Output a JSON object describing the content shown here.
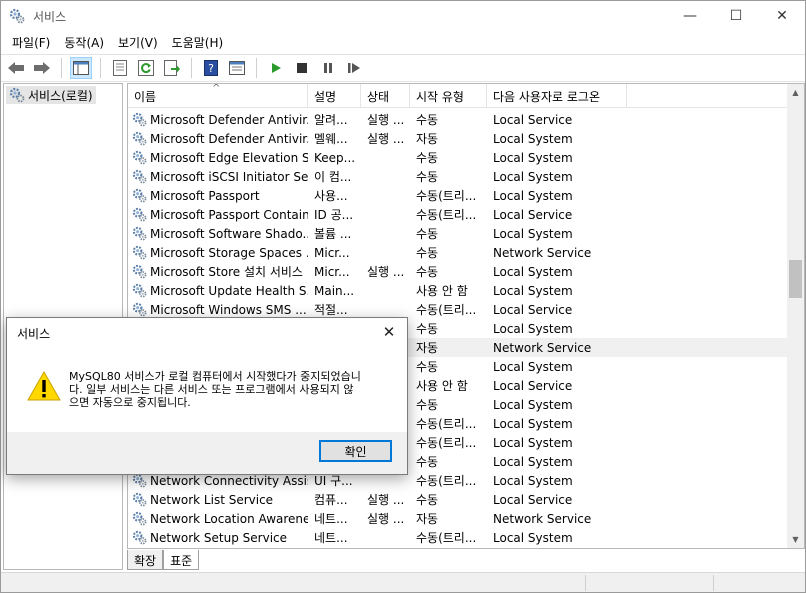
{
  "window": {
    "title": "서비스",
    "minimize_glyph": "—",
    "maximize_glyph": "☐",
    "close_glyph": "✕"
  },
  "menu": [
    "파일(F)",
    "동작(A)",
    "보기(V)",
    "도움말(H)"
  ],
  "toolbar_icons": [
    "back-arrow-icon",
    "forward-arrow-icon",
    "show-tree-icon",
    "properties-icon",
    "refresh-icon",
    "export-list-icon",
    "help-icon",
    "view-icon",
    "start-service-icon",
    "stop-service-icon",
    "pause-service-icon",
    "restart-service-icon"
  ],
  "tree": {
    "root_label": "서비스(로컬)"
  },
  "columns": {
    "name": "이름",
    "desc": "설명",
    "status": "상태",
    "start": "시작 유형",
    "logon": "다음 사용자로 로그온"
  },
  "rows": [
    {
      "name": "Microsoft Defender Antivir...",
      "desc": "알려...",
      "status": "실행 ...",
      "start": "수동",
      "logon": "Local Service"
    },
    {
      "name": "Microsoft Defender Antivir...",
      "desc": "멜웨...",
      "status": "실행 ...",
      "start": "자동",
      "logon": "Local System"
    },
    {
      "name": "Microsoft Edge Elevation S...",
      "desc": "Keep...",
      "status": "",
      "start": "수동",
      "logon": "Local System"
    },
    {
      "name": "Microsoft iSCSI Initiator Se...",
      "desc": "이 컴...",
      "status": "",
      "start": "수동",
      "logon": "Local System"
    },
    {
      "name": "Microsoft Passport",
      "desc": "사용...",
      "status": "",
      "start": "수동(트리...",
      "logon": "Local System"
    },
    {
      "name": "Microsoft Passport Container",
      "desc": "ID 공...",
      "status": "",
      "start": "수동(트리...",
      "logon": "Local Service"
    },
    {
      "name": "Microsoft Software Shado...",
      "desc": "볼륨 ...",
      "status": "",
      "start": "수동",
      "logon": "Local System"
    },
    {
      "name": "Microsoft Storage Spaces ...",
      "desc": "Micr...",
      "status": "",
      "start": "수동",
      "logon": "Network Service"
    },
    {
      "name": "Microsoft Store 설치 서비스",
      "desc": "Micr...",
      "status": "실행 ...",
      "start": "수동",
      "logon": "Local System"
    },
    {
      "name": "Microsoft Update Health S...",
      "desc": "Main...",
      "status": "",
      "start": "사용 안 함",
      "logon": "Local System"
    },
    {
      "name": "Microsoft Windows SMS ...",
      "desc": "적절...",
      "status": "",
      "start": "수동(트리...",
      "logon": "Local Service"
    },
    {
      "name": "",
      "desc": "",
      "status": "",
      "start": "수동",
      "logon": "Local System"
    },
    {
      "name": "",
      "desc": "",
      "status": "",
      "start": "자동",
      "logon": "Network Service"
    },
    {
      "name": "",
      "desc": "",
      "status": "",
      "start": "수동",
      "logon": "Local System"
    },
    {
      "name": "",
      "desc": "",
      "status": "",
      "start": "사용 안 함",
      "logon": "Local Service"
    },
    {
      "name": "",
      "desc": "",
      "status": "",
      "start": "수동",
      "logon": "Local System"
    },
    {
      "name": "",
      "desc": "",
      "status": "",
      "start": "수동(트리...",
      "logon": "Local System"
    },
    {
      "name": "",
      "desc": "",
      "status": "",
      "start": "수동(트리...",
      "logon": "Local System"
    },
    {
      "name": "",
      "desc": "",
      "status": "",
      "start": "수동",
      "logon": "Local System"
    },
    {
      "name": "Network Connectivity Assis...",
      "desc": "UI 구...",
      "status": "",
      "start": "수동(트리...",
      "logon": "Local System"
    },
    {
      "name": "Network List Service",
      "desc": "컴퓨...",
      "status": "실행 ...",
      "start": "수동",
      "logon": "Local Service"
    },
    {
      "name": "Network Location Awareness",
      "desc": "네트...",
      "status": "실행 ...",
      "start": "자동",
      "logon": "Network Service"
    },
    {
      "name": "Network Setup Service",
      "desc": "네트...",
      "status": "",
      "start": "수동(트리...",
      "logon": "Local System"
    }
  ],
  "tabs": [
    "확장",
    "표준"
  ],
  "dialog": {
    "title": "서비스",
    "close_glyph": "✕",
    "message_line1": "MySQL80 서비스가 로컬 컴퓨터에서 시작했다가 중지되었습니",
    "message_line2": "다. 일부 서비스는 다른 서비스 또는 프로그램에서 사용되지 않",
    "message_line3": "으면 자동으로 중지됩니다.",
    "ok_label": "확인"
  },
  "colors": {
    "selection": "#cce8ff",
    "warning_yellow": "#ffd800",
    "accent": "#0078d7"
  }
}
